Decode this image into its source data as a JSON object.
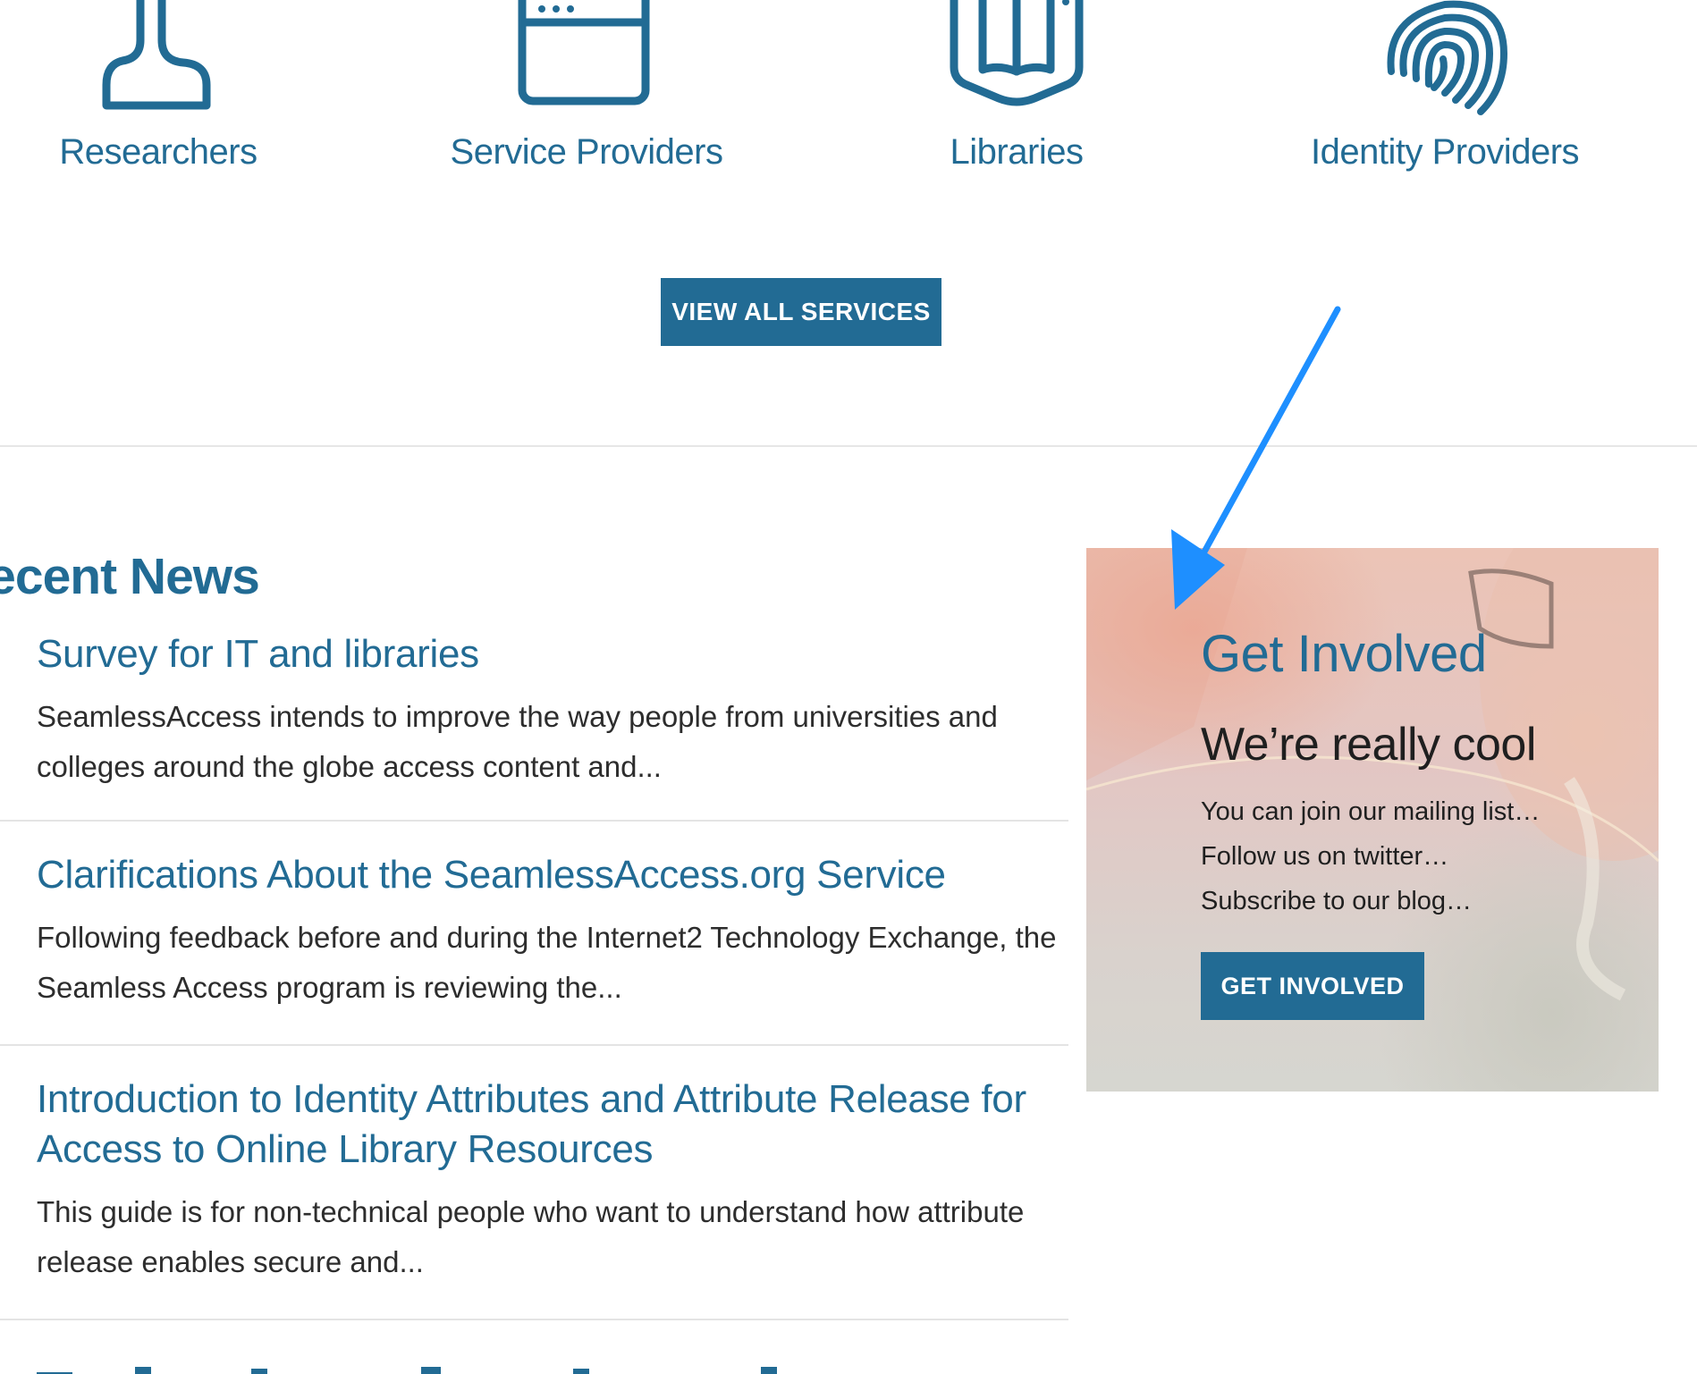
{
  "audiences": [
    {
      "label": "Researchers",
      "icon": "user-icon"
    },
    {
      "label": "Service Providers",
      "icon": "browser-window-icon"
    },
    {
      "label": "Libraries",
      "icon": "open-book-icon"
    },
    {
      "label": "Identity Providers",
      "icon": "fingerprint-icon"
    }
  ],
  "services_button": {
    "label": "VIEW ALL SERVICES"
  },
  "news": {
    "heading": "Recent News",
    "items": [
      {
        "title": "Survey for IT and libraries",
        "excerpt": "SeamlessAccess intends to improve the way people from universities and colleges around the globe access content and..."
      },
      {
        "title": "Clarifications About the SeamlessAccess.org Service",
        "excerpt": "Following feedback before and during the Internet2 Technology Exchange, the Seamless Access program is reviewing the..."
      },
      {
        "title": "Introduction to Identity Attributes and Attribute Release for Access to Online Library Resources",
        "excerpt": "This guide is for non-technical people who want to understand how attribute release enables secure and..."
      }
    ]
  },
  "get_involved": {
    "title": "Get Involved",
    "subtitle": "We’re really cool",
    "body": "You can join our mailing list… Follow us on twitter… Subscribe to our blog…",
    "button_label": "GET INVOLVED"
  },
  "colors": {
    "brand": "#226b94",
    "annotation_arrow": "#1e8fff",
    "divider": "#e6e6e6"
  }
}
